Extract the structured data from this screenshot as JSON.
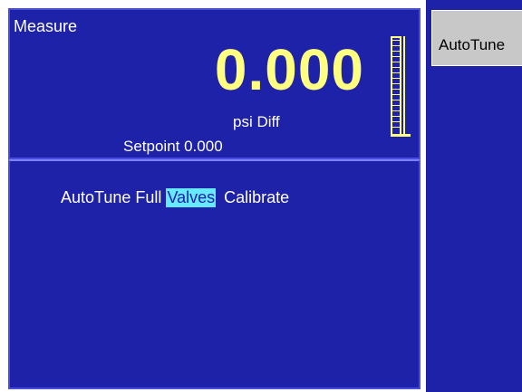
{
  "measure": {
    "title": "Measure",
    "value": "0.000",
    "units": "psi Diff",
    "setpoint_label": "Setpoint 0.000",
    "bar_fill_fraction": 0.0
  },
  "autotune": {
    "label": "AutoTune",
    "options": [
      "Full",
      "Valves",
      "Calibrate"
    ],
    "selected": "Valves"
  },
  "softkeys": {
    "autotune_label": "AutoTune"
  },
  "colors": {
    "panel_bg": "#1e22a8",
    "value_color": "#ffff80",
    "highlight": "#66e8ff"
  }
}
